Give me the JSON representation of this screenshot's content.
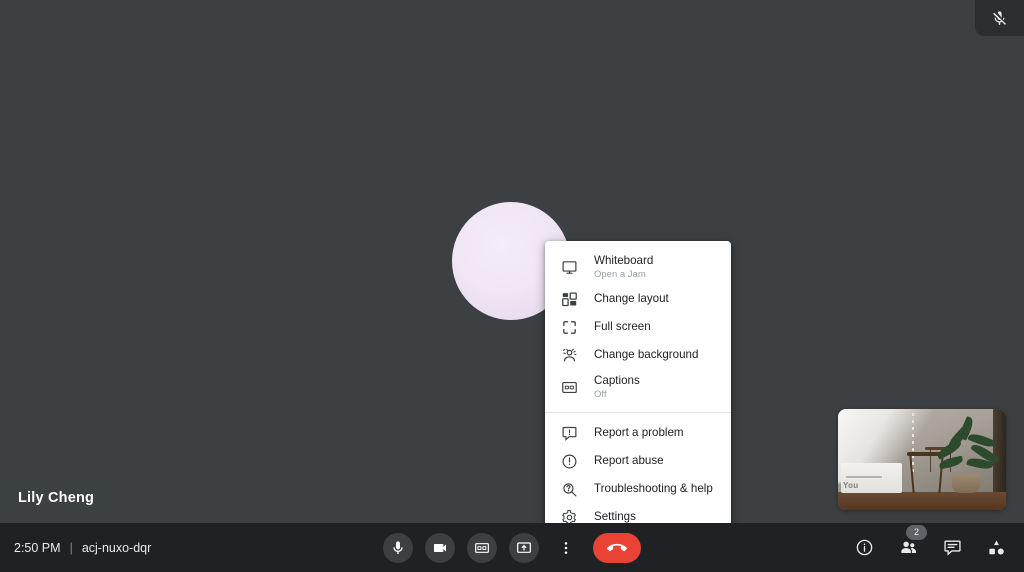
{
  "meeting": {
    "time": "2:50 PM",
    "separator": "|",
    "code": "acj-nuxo-dqr",
    "participant_name": "Lily Cheng",
    "selfview_label": "You",
    "mute_indicator_icon": "mic-off-icon"
  },
  "menu": {
    "items": [
      {
        "label": "Whiteboard",
        "sub": "Open a Jam",
        "icon": "whiteboard-icon"
      },
      {
        "label": "Change layout",
        "sub": "",
        "icon": "change-layout-icon"
      },
      {
        "label": "Full screen",
        "sub": "",
        "icon": "fullscreen-icon"
      },
      {
        "label": "Change background",
        "sub": "",
        "icon": "change-background-icon"
      },
      {
        "label": "Captions",
        "sub": "Off",
        "icon": "captions-icon"
      },
      {
        "label": "Report a problem",
        "sub": "",
        "icon": "report-problem-icon"
      },
      {
        "label": "Report abuse",
        "sub": "",
        "icon": "report-abuse-icon"
      },
      {
        "label": "Troubleshooting & help",
        "sub": "",
        "icon": "troubleshooting-icon"
      },
      {
        "label": "Settings",
        "sub": "",
        "icon": "gear-icon"
      }
    ]
  },
  "controls": {
    "center": [
      {
        "name": "microphone-button",
        "icon": "microphone-icon"
      },
      {
        "name": "camera-button",
        "icon": "camera-icon"
      },
      {
        "name": "captions-button",
        "icon": "closed-captions-icon"
      },
      {
        "name": "present-screen-button",
        "icon": "present-screen-icon"
      },
      {
        "name": "more-options-button",
        "icon": "more-vertical-icon"
      },
      {
        "name": "end-call-button",
        "icon": "hangup-icon"
      }
    ],
    "right": [
      {
        "name": "meeting-details-button",
        "icon": "info-icon",
        "badge": ""
      },
      {
        "name": "participants-button",
        "icon": "people-icon",
        "badge": "2"
      },
      {
        "name": "chat-button",
        "icon": "chat-icon",
        "badge": ""
      },
      {
        "name": "activities-button",
        "icon": "activities-icon",
        "badge": ""
      }
    ]
  },
  "colors": {
    "stage_bg": "#3c4043",
    "bar_bg": "#202124",
    "menu_bg": "#ffffff",
    "hangup_red": "#ea4335",
    "avatar": "#f0e6f4",
    "badge_bg": "#5f6368"
  }
}
